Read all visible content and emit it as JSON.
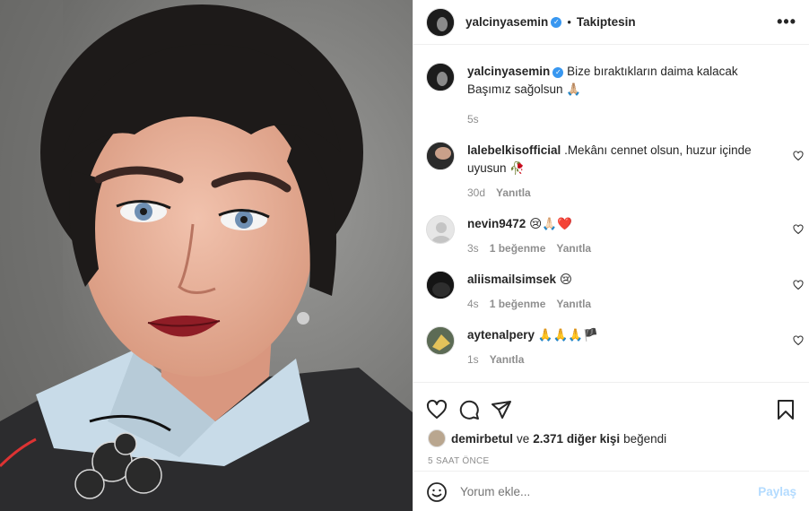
{
  "post": {
    "image_alt": "Portrait photo of a woman with short dark hair"
  },
  "header": {
    "username": "yalcinyasemin",
    "separator": "•",
    "follow_status": "Takiptesin",
    "more": "•••"
  },
  "caption": {
    "username": "yalcinyasemin",
    "line1": "Bize bıraktıkların daima kalacak",
    "line2": "Başımız sağolsun 🙏🏼",
    "time": "5s"
  },
  "comments": [
    {
      "username": "lalebelkisofficial",
      "text": ".Mekânı cennet olsun, huzur içinde uyusun 🥀",
      "time": "30d",
      "likes": "",
      "reply": "Yanıtla"
    },
    {
      "username": "nevin9472",
      "text": "😢🙏🏻❤️",
      "time": "3s",
      "likes": "1 beğenme",
      "reply": "Yanıtla"
    },
    {
      "username": "aliismailsimsek",
      "text": "😢",
      "time": "4s",
      "likes": "1 beğenme",
      "reply": "Yanıtla"
    },
    {
      "username": "aytenalpery",
      "text": "🙏🙏🙏🏴",
      "time": "1s",
      "likes": "",
      "reply": "Yanıtla"
    }
  ],
  "likes": {
    "user": "demirbetul",
    "and": "ve",
    "others": "2.371 diğer kişi",
    "suffix": "beğendi"
  },
  "timestamp": "5 SAAT ÖNCE",
  "add_comment": {
    "placeholder": "Yorum ekle...",
    "post_label": "Paylaş"
  },
  "colors": {
    "verified": "#3897f0",
    "muted": "#8e8e8e",
    "post_disabled": "#b3dbff"
  }
}
